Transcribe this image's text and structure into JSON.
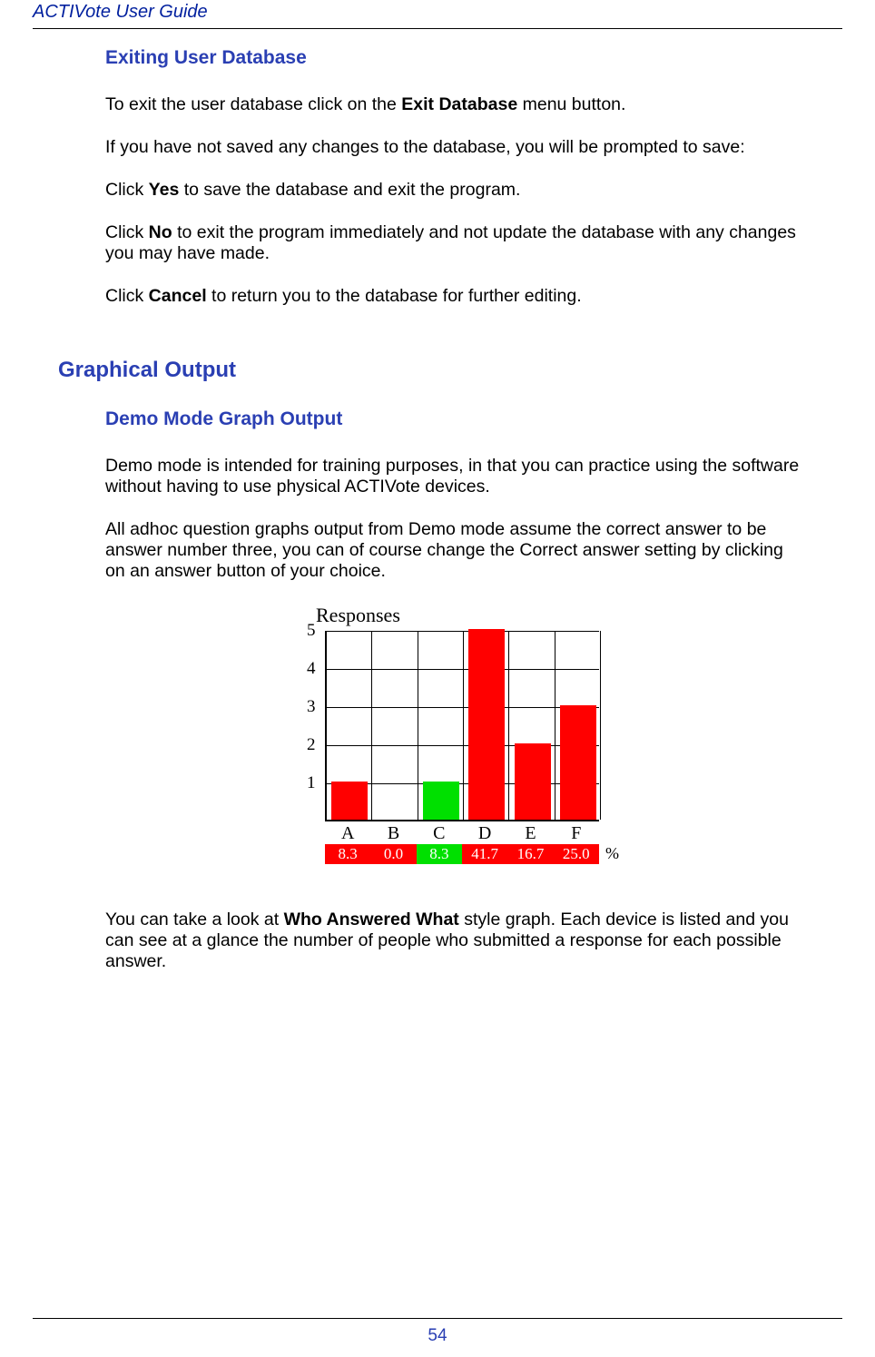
{
  "doc_title": "ACTIVote User Guide",
  "section1": {
    "heading": "Exiting User Database",
    "p1_before": "To exit the user database click on the ",
    "p1_bold": "Exit Database",
    "p1_after": " menu button.",
    "p2": "If you have not saved any changes to the database, you will be prompted to save:",
    "p3_before": "Click ",
    "p3_bold": "Yes",
    "p3_after": " to save the database and exit the program.",
    "p4_before": "Click ",
    "p4_bold": "No",
    "p4_after": " to exit the program immediately and not update the database with any changes you may have made.",
    "p5_before": "Click ",
    "p5_bold": "Cancel",
    "p5_after": " to return you to the database for further editing."
  },
  "section2": {
    "heading": "Graphical Output"
  },
  "section3": {
    "heading": "Demo Mode Graph Output",
    "p1": "Demo mode is intended for training purposes, in that you can practice using the software without having to use physical ACTIVote devices.",
    "p2": "All adhoc question graphs output from Demo mode assume the correct answer to be answer number three, you can of course change the Correct answer setting by clicking on an answer button of your choice.",
    "p3_before": "You can take a look at ",
    "p3_bold": "Who Answered What",
    "p3_after": " style graph. Each device is listed and you can see at a glance the number of people who submitted a response for each possible answer."
  },
  "chart_data": {
    "type": "bar",
    "title": "Responses",
    "categories": [
      "A",
      "B",
      "C",
      "D",
      "E",
      "F"
    ],
    "values": [
      1,
      0,
      1,
      5,
      2,
      3
    ],
    "percentages": [
      "8.3",
      "0.0",
      "8.3",
      "41.7",
      "16.7",
      "25.0"
    ],
    "colors": [
      "red",
      "red",
      "green",
      "red",
      "red",
      "red"
    ],
    "yticks": [
      "1",
      "2",
      "3",
      "4",
      "5"
    ],
    "ylim": [
      0,
      5
    ],
    "pct_suffix": "%"
  },
  "page_number": "54"
}
